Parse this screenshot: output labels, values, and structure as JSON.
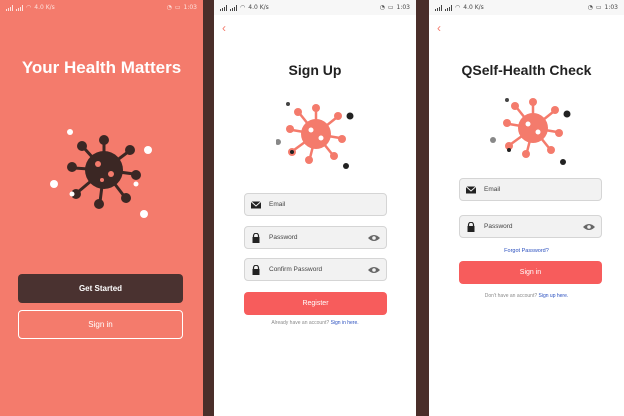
{
  "status_bar": {
    "network_label": "4.0 K/s",
    "time": "1:03"
  },
  "welcome": {
    "title": "Your Health Matters",
    "get_started_label": "Get Started",
    "sign_in_label": "Sign in"
  },
  "signup": {
    "back_glyph": "‹",
    "title": "Sign Up",
    "email_label": "Email",
    "password_label": "Password",
    "confirm_label": "Confirm Password",
    "register_label": "Register",
    "footer_text": "Already have an account?",
    "footer_link": "Sign in here."
  },
  "signin": {
    "back_glyph": "‹",
    "title": "QSelf-Health Check",
    "email_label": "Email",
    "password_label": "Password",
    "forgot_label": "Forgot Password?",
    "sign_in_label": "Sign in",
    "footer_text": "Don't have an account?",
    "footer_link": "Sign up here."
  },
  "colors": {
    "coral_bg": "#f47b6c",
    "dark_brown": "#4a3230",
    "button_coral": "#f75c5c",
    "link_blue": "#2a4fbf"
  },
  "icons": [
    "signal-icon",
    "wifi-icon",
    "battery-icon",
    "virus-icon",
    "mail-icon",
    "lock-icon",
    "eye-icon",
    "back-arrow-icon"
  ]
}
